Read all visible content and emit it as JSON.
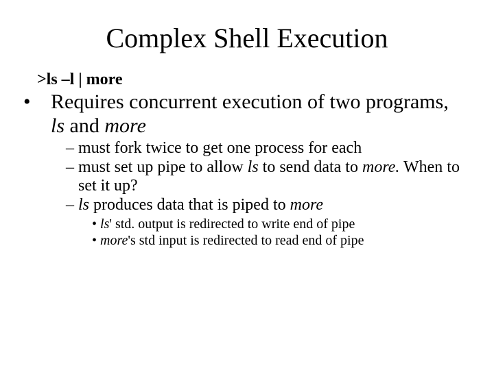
{
  "title": "Complex Shell Execution",
  "command": ">ls –l | more",
  "bullet1": {
    "pre": "Requires concurrent execution of two programs, ",
    "ls": "ls",
    "mid": " and ",
    "more": "more"
  },
  "sub": {
    "a": "– must fork twice to get one process for each",
    "b_pre": "– must set up pipe to allow ",
    "b_ls": "ls",
    "b_mid": " to send data to ",
    "b_more": "more.",
    "b_tail": " When to set it up?",
    "c_dash": "– ",
    "c_ls": "ls",
    "c_mid": " produces data that is piped to ",
    "c_more": "more"
  },
  "subsub": {
    "a_bul": "• ",
    "a_ls": "ls",
    "a_rest": "' std. output is redirected to write end of pipe",
    "b_bul": "• ",
    "b_more": "more",
    "b_rest": "'s std input is redirected to read end of pipe"
  }
}
